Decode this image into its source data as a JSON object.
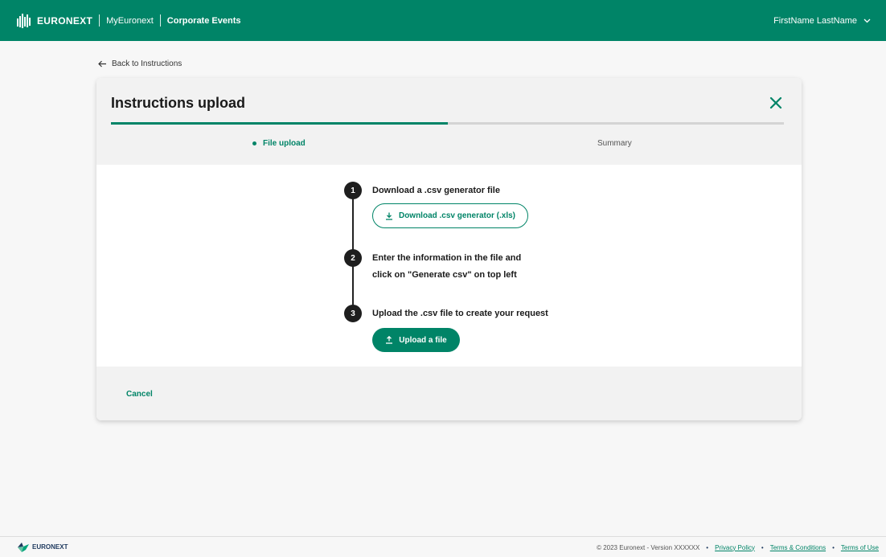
{
  "header": {
    "brand": "EURONEXT",
    "nav_link": "MyEuronext",
    "current_section": "Corporate Events",
    "user_name": "FirstName LastName"
  },
  "back_link": "Back to Instructions",
  "card": {
    "title": "Instructions upload",
    "progress": 0.5,
    "steps": [
      {
        "label": "File upload",
        "state": "active"
      },
      {
        "label": "Summary",
        "state": "inactive"
      }
    ],
    "instructions": [
      {
        "number": "1",
        "text": "Download a .csv generator file"
      },
      {
        "number": "2",
        "line1": "Enter the information in the file and",
        "line2": "click on \"Generate csv\" on top left"
      },
      {
        "number": "3",
        "text": "Upload the .csv file to create your request"
      }
    ],
    "download_button": "Download .csv generator (.xls)",
    "upload_button": "Upload a file",
    "cancel": "Cancel"
  },
  "footer": {
    "brand": "EURONEXT",
    "copyright": "© 2023 Euronext - Version XXXXXX",
    "links": [
      "Privacy Policy",
      "Terms & Conditions",
      "Terms of Use"
    ]
  },
  "colors": {
    "accent": "#008467",
    "dark": "#1e1e1e",
    "panel": "#f2f2f2"
  }
}
